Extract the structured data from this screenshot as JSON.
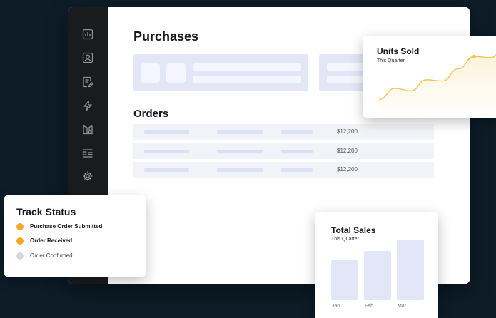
{
  "page": {
    "title": "Purchases"
  },
  "sidebar": {
    "icons": [
      "chart-icon",
      "user-icon",
      "document-edit-icon",
      "lightning-icon",
      "book-icon",
      "list-icon",
      "settings-icon"
    ]
  },
  "orders": {
    "title": "Orders",
    "rows": [
      {
        "amount": "$12,200"
      },
      {
        "amount": "$12,200"
      },
      {
        "amount": "$12,200"
      }
    ]
  },
  "units_sold": {
    "title": "Units Sold",
    "subtitle": "This Quarter",
    "line_color": "#f3c24a",
    "trend": [
      10,
      28,
      24,
      42,
      40,
      60,
      80,
      78,
      95
    ],
    "highlight_index": 6
  },
  "track_status": {
    "title": "Track Status",
    "items": [
      {
        "label": "Purchase Order Submitted",
        "status": "done",
        "color": "#f5a623"
      },
      {
        "label": "Order Received",
        "status": "done",
        "color": "#f5a623"
      },
      {
        "label": "Order Confirmed",
        "status": "pending",
        "color": "#d5d8dc"
      }
    ]
  },
  "total_sales": {
    "title": "Total Sales",
    "subtitle": "This Quarter",
    "bar_color": "#e3e6f7",
    "bars": [
      {
        "label": "Jan",
        "value": 0.67
      },
      {
        "label": "Feb",
        "value": 0.81
      },
      {
        "label": "Mar",
        "value": 1.0
      }
    ]
  }
}
